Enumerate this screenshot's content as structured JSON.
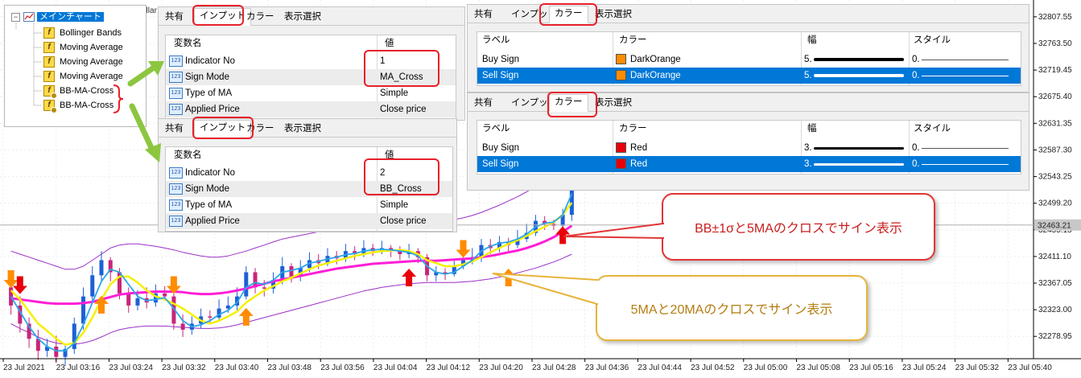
{
  "tree": {
    "root": "メインチャート",
    "items": [
      "Bollinger Bands",
      "Moving Average",
      "Moving Average",
      "Moving Average",
      "BB-MA-Cross",
      "BB-MA-Cross"
    ]
  },
  "partial_title": "ollar",
  "input_panels": [
    {
      "tabs": [
        "共有",
        "インプット",
        "カラー",
        "表示選択"
      ],
      "columns": [
        "変数名",
        "値"
      ],
      "rows": [
        {
          "icon": "123",
          "name": "Indicator No",
          "value": "1"
        },
        {
          "icon": "123",
          "name": "Sign Mode",
          "value": "MA_Cross"
        },
        {
          "icon": "123",
          "name": "Type of MA",
          "value": "Simple"
        },
        {
          "icon": "123",
          "name": "Applied Price",
          "value": "Close price"
        }
      ]
    },
    {
      "tabs": [
        "共有",
        "インプット",
        "カラー",
        "表示選択"
      ],
      "columns": [
        "変数名",
        "値"
      ],
      "rows": [
        {
          "icon": "123",
          "name": "Indicator No",
          "value": "2"
        },
        {
          "icon": "123",
          "name": "Sign Mode",
          "value": "BB_Cross"
        },
        {
          "icon": "123",
          "name": "Type of MA",
          "value": "Simple"
        },
        {
          "icon": "123",
          "name": "Applied Price",
          "value": "Close price"
        }
      ]
    }
  ],
  "color_panels": [
    {
      "tabs": [
        "共有",
        "インプット",
        "カラー",
        "表示選択"
      ],
      "columns": [
        "ラベル",
        "カラー",
        "幅",
        "スタイル"
      ],
      "rows": [
        {
          "label": "Buy Sign",
          "color_name": "DarkOrange",
          "color": "#ff8c00",
          "width": "5.",
          "style": "0."
        },
        {
          "label": "Sell Sign",
          "color_name": "DarkOrange",
          "color": "#ff8c00",
          "width": "5.",
          "style": "0.",
          "selected": true
        }
      ]
    },
    {
      "tabs": [
        "共有",
        "インプット",
        "カラー",
        "表示選択"
      ],
      "columns": [
        "ラベル",
        "カラー",
        "幅",
        "スタイル"
      ],
      "rows": [
        {
          "label": "Buy Sign",
          "color_name": "Red",
          "color": "#e8000b",
          "width": "3.",
          "style": "0."
        },
        {
          "label": "Sell Sign",
          "color_name": "Red",
          "color": "#e8000b",
          "width": "3.",
          "style": "0.",
          "selected": true
        }
      ]
    }
  ],
  "callouts": {
    "bb_cross": "BB±1σと5MAのクロスでサイン表示",
    "ma_cross": "5MAと20MAのクロスでサイン表示"
  },
  "colors": {
    "selection": "#0078d7",
    "highlight": "#e8202a",
    "arrow_green": "#8cc63f",
    "bull_candle": "#1e5fd6",
    "bear_candle": "#c8257a",
    "bb_band": "#9b30c8",
    "ma20": "#ff1ed6",
    "ma5": "#f5f000",
    "ma_fast": "#2aa7e8",
    "sign_orange": "#ff8c00",
    "sign_red": "#e8000b"
  },
  "chart_data": {
    "type": "candlestick",
    "y_ticks": [
      "32807.55",
      "32763.50",
      "32719.45",
      "32675.40",
      "32631.35",
      "32587.30",
      "32543.25",
      "32499.20",
      "32455.15",
      "32411.10",
      "32367.05",
      "32323.00",
      "32278.95"
    ],
    "ylim": [
      32250,
      32830
    ],
    "x_ticks": [
      "23 Jul 2021",
      "23 Jul 03:16",
      "23 Jul 03:24",
      "23 Jul 03:32",
      "23 Jul 03:40",
      "23 Jul 03:48",
      "23 Jul 03:56",
      "23 Jul 04:04",
      "23 Jul 04:12",
      "23 Jul 04:20",
      "23 Jul 04:28",
      "23 Jul 04:36",
      "23 Jul 04:44",
      "23 Jul 04:52",
      "23 Jul 05:00",
      "23 Jul 05:08",
      "23 Jul 05:16",
      "23 Jul 05:24",
      "23 Jul 05:32",
      "23 Jul 05:40"
    ],
    "current_price": "32463.21",
    "candles": [
      [
        32360,
        32330,
        32375,
        32315
      ],
      [
        32330,
        32300,
        32345,
        32285
      ],
      [
        32300,
        32275,
        32310,
        32260
      ],
      [
        32275,
        32255,
        32290,
        32240
      ],
      [
        32255,
        32262,
        32275,
        32245
      ],
      [
        32262,
        32245,
        32280,
        32235
      ],
      [
        32245,
        32258,
        32265,
        32230
      ],
      [
        32258,
        32300,
        32310,
        32250
      ],
      [
        32300,
        32345,
        32360,
        32290
      ],
      [
        32345,
        32380,
        32395,
        32335
      ],
      [
        32380,
        32405,
        32420,
        32370
      ],
      [
        32405,
        32385,
        32410,
        32370
      ],
      [
        32385,
        32350,
        32392,
        32340
      ],
      [
        32350,
        32330,
        32360,
        32318
      ],
      [
        32330,
        32342,
        32355,
        32322
      ],
      [
        32342,
        32335,
        32360,
        32325
      ],
      [
        32335,
        32350,
        32365,
        32328
      ],
      [
        32350,
        32345,
        32362,
        32338
      ],
      [
        32345,
        32300,
        32350,
        32290
      ],
      [
        32300,
        32290,
        32315,
        32278
      ],
      [
        32290,
        32300,
        32312,
        32282
      ],
      [
        32300,
        32312,
        32325,
        32292
      ],
      [
        32312,
        32310,
        32322,
        32300
      ],
      [
        32310,
        32325,
        32340,
        32305
      ],
      [
        32325,
        32330,
        32345,
        32318
      ],
      [
        32330,
        32345,
        32360,
        32322
      ],
      [
        32345,
        32385,
        32395,
        32340
      ],
      [
        32385,
        32360,
        32392,
        32350
      ],
      [
        32360,
        32358,
        32372,
        32345
      ],
      [
        32358,
        32372,
        32385,
        32350
      ],
      [
        32372,
        32395,
        32410,
        32365
      ],
      [
        32395,
        32378,
        32400,
        32368
      ],
      [
        32378,
        32392,
        32405,
        32370
      ],
      [
        32392,
        32405,
        32418,
        32385
      ],
      [
        32405,
        32400,
        32415,
        32390
      ],
      [
        32400,
        32412,
        32425,
        32395
      ],
      [
        32412,
        32408,
        32420,
        32398
      ],
      [
        32408,
        32420,
        32432,
        32402
      ],
      [
        32420,
        32415,
        32428,
        32405
      ],
      [
        32415,
        32425,
        32438,
        32410
      ],
      [
        32425,
        32420,
        32432,
        32412
      ],
      [
        32420,
        32425,
        32437,
        32415
      ],
      [
        32425,
        32420,
        32430,
        32410
      ],
      [
        32420,
        32415,
        32428,
        32405
      ],
      [
        32415,
        32420,
        32432,
        32408
      ],
      [
        32420,
        32410,
        32425,
        32400
      ],
      [
        32410,
        32380,
        32415,
        32370
      ],
      [
        32380,
        32385,
        32395,
        32370
      ],
      [
        32385,
        32382,
        32392,
        32372
      ],
      [
        32382,
        32395,
        32405,
        32378
      ],
      [
        32395,
        32405,
        32418,
        32390
      ],
      [
        32405,
        32410,
        32425,
        32398
      ],
      [
        32410,
        32430,
        32440,
        32402
      ],
      [
        32430,
        32425,
        32440,
        32415
      ],
      [
        32425,
        32435,
        32445,
        32418
      ],
      [
        32435,
        32430,
        32442,
        32420
      ],
      [
        32430,
        32440,
        32455,
        32425
      ],
      [
        32440,
        32450,
        32465,
        32435
      ],
      [
        32450,
        32470,
        32480,
        32445
      ],
      [
        32470,
        32465,
        32478,
        32455
      ],
      [
        32465,
        32462,
        32472,
        32455
      ],
      [
        32462,
        32480,
        32490,
        32455
      ],
      [
        32480,
        32530,
        32560,
        32470
      ]
    ],
    "bb_upper": [
      32420,
      32415,
      32410,
      32405,
      32400,
      32395,
      32390,
      32390,
      32395,
      32405,
      32415,
      32425,
      32430,
      32432,
      32432,
      32430,
      32428,
      32425,
      32422,
      32418,
      32415,
      32412,
      32410,
      32410,
      32412,
      32416,
      32420,
      32425,
      32430,
      32435,
      32440,
      32443,
      32446,
      32449,
      32452,
      32455,
      32457,
      32459,
      32461,
      32463,
      32464,
      32465,
      32466,
      32467,
      32468,
      32469,
      32469,
      32469,
      32470,
      32472,
      32475,
      32479,
      32484,
      32490,
      32496,
      32503,
      32510,
      32518,
      32527,
      32536,
      32545,
      32555,
      32565
    ],
    "bb_lower": [
      32300,
      32292,
      32285,
      32278,
      32272,
      32268,
      32266,
      32266,
      32268,
      32272,
      32278,
      32285,
      32290,
      32293,
      32295,
      32296,
      32296,
      32296,
      32295,
      32294,
      32293,
      32292,
      32292,
      32293,
      32295,
      32298,
      32302,
      32306,
      32310,
      32314,
      32318,
      32322,
      32326,
      32330,
      32334,
      32338,
      32342,
      32346,
      32350,
      32354,
      32357,
      32360,
      32362,
      32364,
      32366,
      32367,
      32368,
      32368,
      32368,
      32368,
      32369,
      32370,
      32372,
      32374,
      32377,
      32380,
      32384,
      32388,
      32392,
      32397,
      32402,
      32408,
      32415
    ],
    "ma20": [
      32342,
      32340,
      32338,
      32336,
      32334,
      32333,
      32333,
      32333,
      32334,
      32336,
      32340,
      32344,
      32348,
      32350,
      32351,
      32352,
      32353,
      32353,
      32353,
      32352,
      32350,
      32349,
      32349,
      32350,
      32352,
      32355,
      32358,
      32362,
      32366,
      32370,
      32373,
      32376,
      32379,
      32382,
      32385,
      32388,
      32391,
      32393,
      32395,
      32397,
      32399,
      32400,
      32401,
      32402,
      32403,
      32404,
      32404,
      32404,
      32405,
      32406,
      32407,
      32408,
      32410,
      32412,
      32415,
      32418,
      32421,
      32425,
      32430,
      32436,
      32443,
      32452,
      32462
    ],
    "ma5": [
      32355,
      32340,
      32320,
      32300,
      32288,
      32275,
      32265,
      32268,
      32285,
      32310,
      32340,
      32365,
      32378,
      32378,
      32368,
      32355,
      32345,
      32340,
      32333,
      32325,
      32315,
      32305,
      32300,
      32305,
      32312,
      32320,
      32335,
      32345,
      32355,
      32362,
      32370,
      32376,
      32383,
      32390,
      32396,
      32400,
      32404,
      32408,
      32412,
      32415,
      32418,
      32420,
      32421,
      32422,
      32420,
      32415,
      32405,
      32400,
      32395,
      32395,
      32398,
      32403,
      32410,
      32418,
      32425,
      32432,
      32438,
      32445,
      32453,
      32460,
      32468,
      32480,
      32500
    ],
    "ma_fast": [
      32345,
      32320,
      32295,
      32275,
      32262,
      32255,
      32255,
      32268,
      32298,
      32335,
      32370,
      32390,
      32385,
      32365,
      32345,
      32338,
      32340,
      32343,
      32325,
      32305,
      32295,
      32298,
      32305,
      32315,
      32322,
      32335,
      32360,
      32368,
      32365,
      32372,
      32385,
      32388,
      32392,
      32400,
      32403,
      32407,
      32410,
      32414,
      32416,
      32420,
      32422,
      32423,
      32422,
      32420,
      32418,
      32412,
      32395,
      32385,
      32382,
      32385,
      32395,
      32405,
      32420,
      32428,
      32433,
      32435,
      32440,
      32448,
      32460,
      32466,
      32468,
      32480,
      32515
    ],
    "signals": [
      {
        "type": "sell",
        "color": "sign_orange",
        "index": 0,
        "price": 32375
      },
      {
        "type": "sell",
        "color": "sign_red",
        "index": 1,
        "price": 32365
      },
      {
        "type": "buy",
        "color": "sign_orange",
        "index": 10,
        "price": 32330
      },
      {
        "type": "sell",
        "color": "sign_orange",
        "index": 18,
        "price": 32365
      },
      {
        "type": "buy",
        "color": "sign_orange",
        "index": 26,
        "price": 32310
      },
      {
        "type": "buy",
        "color": "sign_red",
        "index": 44,
        "price": 32375
      },
      {
        "type": "sell",
        "color": "sign_orange",
        "index": 50,
        "price": 32425
      },
      {
        "type": "buy",
        "color": "sign_orange",
        "index": 55,
        "price": 32375
      },
      {
        "type": "buy",
        "color": "sign_red",
        "index": 61,
        "price": 32445
      }
    ]
  }
}
